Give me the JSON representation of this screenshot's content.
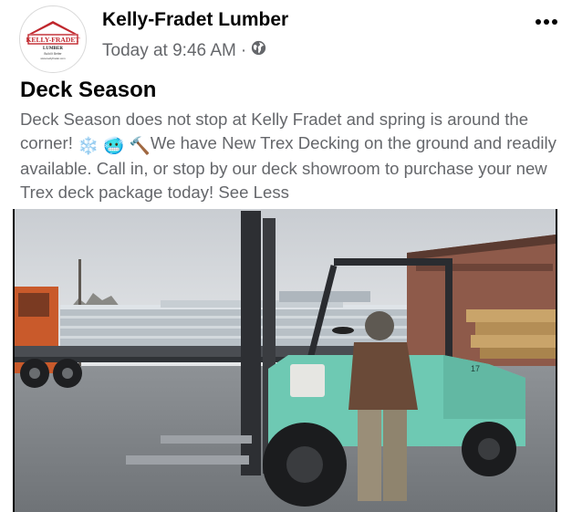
{
  "post": {
    "page_name": "Kelly-Fradet Lumber",
    "timestamp": "Today at 9:46 AM",
    "separator": "·",
    "title": "Deck Season",
    "body_part1": "Deck Season does not stop at Kelly Fradet and spring is around the corner! ",
    "emoji_snowflake": "❄️",
    "emoji_cold_face": "🥶",
    "emoji_hammer": "🔨",
    "body_part2": "We have New Trex Decking on the ground and readily available. Call in, or stop by our deck showroom to purchase your new Trex deck package today! ",
    "see_less": "See Less"
  },
  "logo": {
    "name": "KELLY-FRADET",
    "sub": "LUMBER",
    "tagline": "Build It Better",
    "url": "www.kellyfradet.com"
  },
  "photo": {
    "forklift_unit_number": "17"
  },
  "icons": {
    "privacy": "globe-icon",
    "more": "more-options-icon"
  },
  "colors": {
    "text_primary": "#050505",
    "text_secondary": "#65676b",
    "logo_red": "#c0272d",
    "forklift_teal": "#6ec9b3"
  }
}
